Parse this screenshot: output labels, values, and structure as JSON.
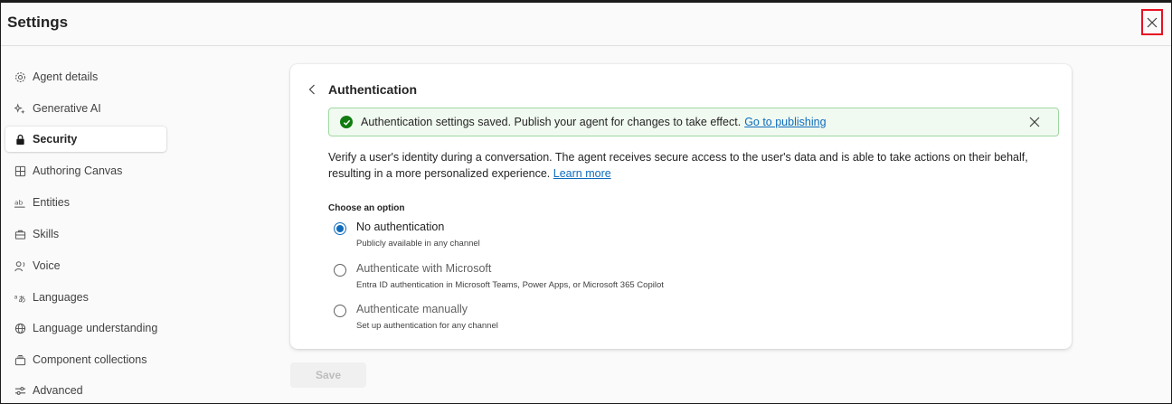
{
  "header": {
    "title": "Settings",
    "close_icon": "close-icon",
    "close_highlight_color": "#e81123"
  },
  "sidebar": {
    "items": [
      {
        "label": "Agent details",
        "icon": "gear-icon",
        "active": false
      },
      {
        "label": "Generative AI",
        "icon": "sparkle-icon",
        "active": false
      },
      {
        "label": "Security",
        "icon": "lock-icon",
        "active": true
      },
      {
        "label": "Authoring Canvas",
        "icon": "grid-icon",
        "active": false
      },
      {
        "label": "Entities",
        "icon": "ab-text-icon",
        "active": false
      },
      {
        "label": "Skills",
        "icon": "toolbox-icon",
        "active": false
      },
      {
        "label": "Voice",
        "icon": "person-voice-icon",
        "active": false
      },
      {
        "label": "Languages",
        "icon": "translate-icon",
        "active": false
      },
      {
        "label": "Language understanding",
        "icon": "globe-icon",
        "active": false
      },
      {
        "label": "Component collections",
        "icon": "collection-icon",
        "active": false
      },
      {
        "label": "Advanced",
        "icon": "sliders-icon",
        "active": false
      }
    ]
  },
  "main": {
    "title": "Authentication",
    "banner": {
      "message": "Authentication settings saved. Publish your agent for changes to take effect.",
      "link": "Go to publishing",
      "status_color": "#107c10"
    },
    "description": "Verify a user's identity during a conversation. The agent receives secure access to the user's data and is able to take actions on their behalf, resulting in a more personalized experience.",
    "learn_more": "Learn more",
    "options_label": "Choose an option",
    "options": [
      {
        "label": "No authentication",
        "sub": "Publicly available in any channel",
        "selected": true
      },
      {
        "label": "Authenticate with Microsoft",
        "sub": "Entra ID authentication in Microsoft Teams, Power Apps, or Microsoft 365 Copilot",
        "selected": false
      },
      {
        "label": "Authenticate manually",
        "sub": "Set up authentication for any channel",
        "selected": false
      }
    ],
    "save_label": "Save",
    "accent_color": "#0f6cbd"
  }
}
